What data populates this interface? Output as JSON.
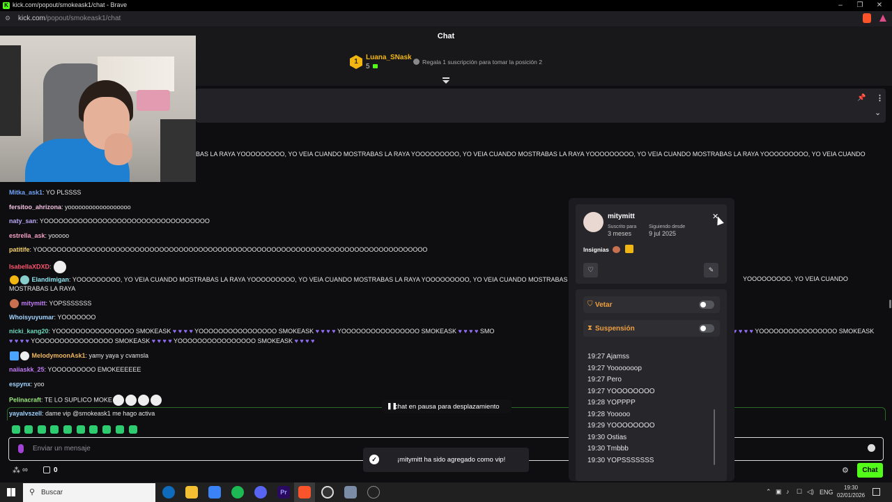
{
  "browser": {
    "title": "kick.com/popout/smokeask1/chat - Brave",
    "url_host": "kick.com",
    "url_path": "/popout/smokeask1/chat"
  },
  "chat": {
    "header": "Chat",
    "leaderboard": {
      "rank": "1",
      "user": "Luana_SNask",
      "count": "5",
      "cta": "Regala 1 suscripción para tomar la posición 2"
    },
    "scrolling_line": "BAS LA RAYA YOOOOOOOOO, YO VEIA CUANDO MOSTRABAS LA RAYA YOOOOOOOOO, YO VEIA CUANDO MOSTRABAS LA RAYA YOOOOOOOOO, YO VEIA CUANDO MOSTRABAS LA RAYA YOOOOOOOOO, YO VEIA CUANDO",
    "messages": [
      {
        "user": "Mitka_ask1",
        "text": ": YO PLSSSS"
      },
      {
        "user": "fersitoo_ahrizona",
        "text": ": yoooooooooooooooooo"
      },
      {
        "user": "naty_san",
        "text": ": YOOOOOOOOOOOOOOOOOOOOOOOOOOOOOOOOOO"
      },
      {
        "user": "estrella_ask",
        "text": ": yooooo"
      },
      {
        "user": "patitife",
        "text": ": YOOOOOOOOOOOOOOOOOOOOOOOOOOOOOOOOOOOOOOOOOOOOOOOOOOOOOOOOOOOOOOOOOOOOOOOOOOOOOOOO"
      },
      {
        "user": "IsabellaXDXD",
        "text": ":"
      },
      {
        "user": "Elandimigan",
        "text": ": YOOOOOOOOO, YO VEIA CUANDO MOSTRABAS LA RAYA YOOOOOOOOO, YO VEIA CUANDO MOSTRABAS LA RAYA YOOOOOOOOO, YO VEIA CUANDO MOSTRABAS LA RAYA",
        "text2": "MOSTRABAS LA RAYA",
        "text3": "YOOOOOOOOO, YO VEIA CUANDO"
      },
      {
        "user": "mitymitt",
        "text": ": YOPSSSSSSS"
      },
      {
        "user": "Whoisyuyumar",
        "text": ": YOOOOOOO"
      },
      {
        "user": "nicki_kang20",
        "text": ": YOOOOOOOOOOOOOOOO SMOKEASK",
        "text2": "YOOOOOOOOOOOOOOOO SMOKEASK",
        "text3": "YOOOOOOOOOOOOOOOO SMOKEASK",
        "text4": "YOOOOOOOOOOOOOOOO SMOKEASK",
        "text5": "YOOOOOOOOOOOOOOOO SMOKEASK",
        "text6": "YOOOOOOOOOOOOOOOO SMOKEASK",
        "text_prefix": "SMOKEASK",
        "text_cut": "YOOOOOOOOOOOOOOOO SMOKEASK",
        "text_mid": "SMO"
      },
      {
        "user": "MelodymoonAsk1",
        "text": ": yamy yaya y cvamsla"
      },
      {
        "user": "naiiaskk_25",
        "text": ": YOOOOOOOOO EMOKEEEEEE"
      },
      {
        "user": "espynx",
        "text": ": yoo"
      },
      {
        "user": "Pelinacraft",
        "text": ": TE LO SUPLICO MOKE"
      },
      {
        "user": "yayalvszell",
        "text": ": dame vip @smokeask1 me hago activa"
      }
    ],
    "pause_text": "chat en pausa para desplazamiento",
    "input_placeholder": "Enviar un mensaje",
    "points": "0",
    "chat_button": "Chat",
    "toast": "¡mitymitt ha sido agregado como vip!"
  },
  "user_card": {
    "username": "mitymitt",
    "sub_label": "Suscrito para",
    "sub_value": "3 meses",
    "follow_label": "Siguiendo desde",
    "follow_value": "9 jul 2025",
    "badges_label": "Insignias",
    "ban_label": "Vetar",
    "timeout_label": "Suspensión",
    "log": [
      {
        "time": "19:27",
        "text": "Ajamss"
      },
      {
        "time": "19:27",
        "text": "Yooooooop"
      },
      {
        "time": "19:27",
        "text": "Pero"
      },
      {
        "time": "19:27",
        "text": "YOOOOOOOO"
      },
      {
        "time": "19:28",
        "text": "YOPPPP"
      },
      {
        "time": "19:28",
        "text": "Yooooo"
      },
      {
        "time": "19:29",
        "text": "YOOOOOOOO"
      },
      {
        "time": "19:30",
        "text": "Ostias"
      },
      {
        "time": "19:30",
        "text": "Tmbbb"
      },
      {
        "time": "19:30",
        "text": "YOPSSSSSSS"
      }
    ]
  },
  "taskbar": {
    "search": "Buscar",
    "lang": "ENG",
    "time": "19:30",
    "date": "02/01/2026"
  }
}
